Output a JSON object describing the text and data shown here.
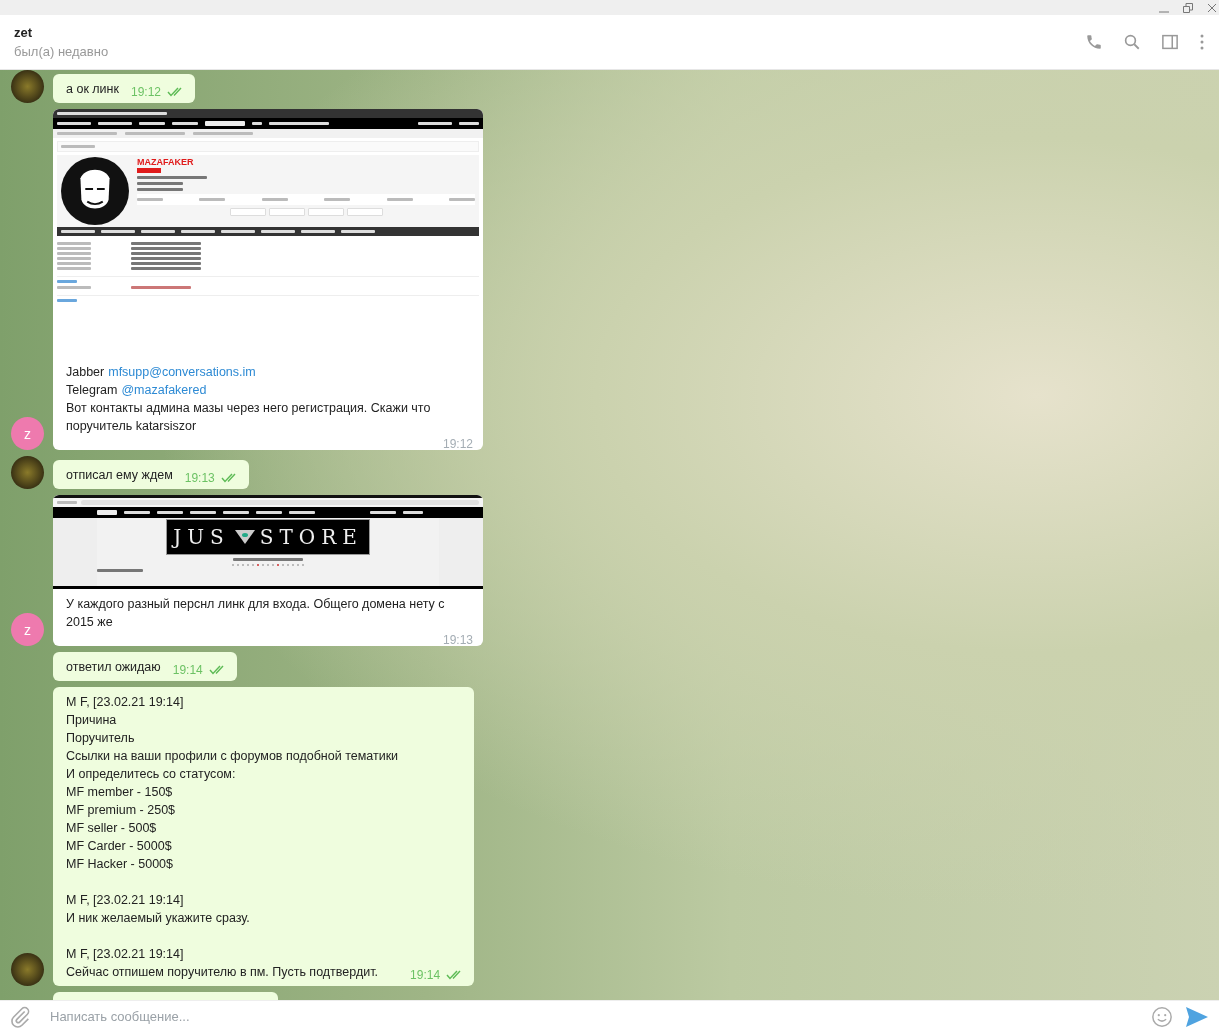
{
  "header": {
    "name": "zet",
    "status": "был(а) недавно"
  },
  "messages": [
    {
      "outgoing": true,
      "avatar": true,
      "read": true,
      "text": "а ок линк",
      "time": "19:12"
    },
    {
      "outgoing": false,
      "avatar": true,
      "avatar_initial": "z",
      "image": {
        "kind": "forum-profile",
        "name": "MAZAFAKER"
      },
      "links": [
        {
          "label": "Jabber",
          "link": "mfsupp@conversations.im"
        },
        {
          "label": "Telegram",
          "link": "@mazafakered"
        }
      ],
      "text": "Вот контакты админа мазы через него регистрация. Скажи что поручитель katarsiszor",
      "time": "19:12"
    },
    {
      "outgoing": true,
      "avatar": true,
      "read": true,
      "text": "отписал ему ждем",
      "time": "19:13"
    },
    {
      "outgoing": false,
      "avatar": true,
      "avatar_initial": "z",
      "image": {
        "kind": "store-banner",
        "logo_left": "JUS",
        "logo_right": "STORE"
      },
      "text": "У каждого разный перснл линк для входа. Общего домена нету с 2015 же",
      "time": "19:13"
    },
    {
      "outgoing": true,
      "avatar": false,
      "read": true,
      "text": "ответил ожидаю",
      "time": "19:14"
    },
    {
      "outgoing": true,
      "avatar": true,
      "read": true,
      "text": "M F, [23.02.21 19:14]\nПричина\nПоручитель\nСсылки на ваши профили с форумов подобной тематики\nИ определитесь со статусом:\nMF member - 150$\nMF premium - 250$\nMF seller - 500$\nMF Carder - 5000$\nMF Hacker - 5000$\n\nM F, [23.02.21 19:14]\nИ ник желаемый укажите сразу.\n\nM F, [23.02.21 19:14]\nСейчас отпишем поручителю в пм. Пусть подтвердит.",
      "time": "19:14"
    },
    {
      "outgoing": true,
      "avatar": false,
      "partial": true
    }
  ],
  "composer": {
    "placeholder": "Написать сообщение..."
  }
}
